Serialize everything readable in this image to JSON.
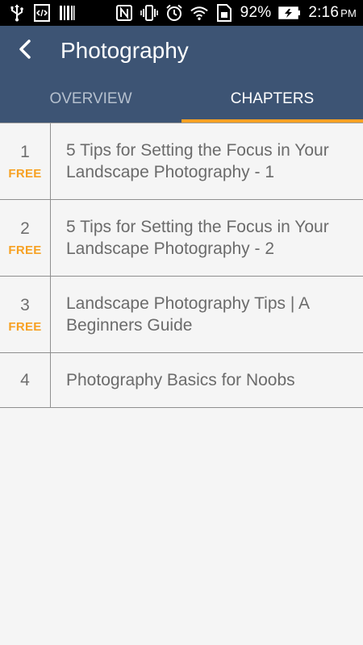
{
  "status_bar": {
    "icons_left": [
      "usb-icon",
      "code-icon",
      "barcode-icon"
    ],
    "icons_right": [
      "nfc-icon",
      "vibrate-icon",
      "alarm-icon",
      "wifi-icon",
      "sim-icon"
    ],
    "battery": "92%",
    "time": "2:16",
    "ampm": "PM"
  },
  "app_bar": {
    "title": "Photography"
  },
  "tabs": [
    {
      "label": "OVERVIEW",
      "active": false
    },
    {
      "label": "CHAPTERS",
      "active": true
    }
  ],
  "accent_color": "#f7a123",
  "header_color": "#3d5474",
  "chapters": [
    {
      "number": "1",
      "badge": "FREE",
      "title": "5 Tips for Setting the Focus in Your Landscape Photography - 1"
    },
    {
      "number": "2",
      "badge": "FREE",
      "title": "5 Tips for Setting the Focus in Your Landscape Photography - 2"
    },
    {
      "number": "3",
      "badge": "FREE",
      "title": "Landscape Photography Tips | A Beginners Guide"
    },
    {
      "number": "4",
      "badge": "",
      "title": "Photography Basics for Noobs"
    }
  ]
}
